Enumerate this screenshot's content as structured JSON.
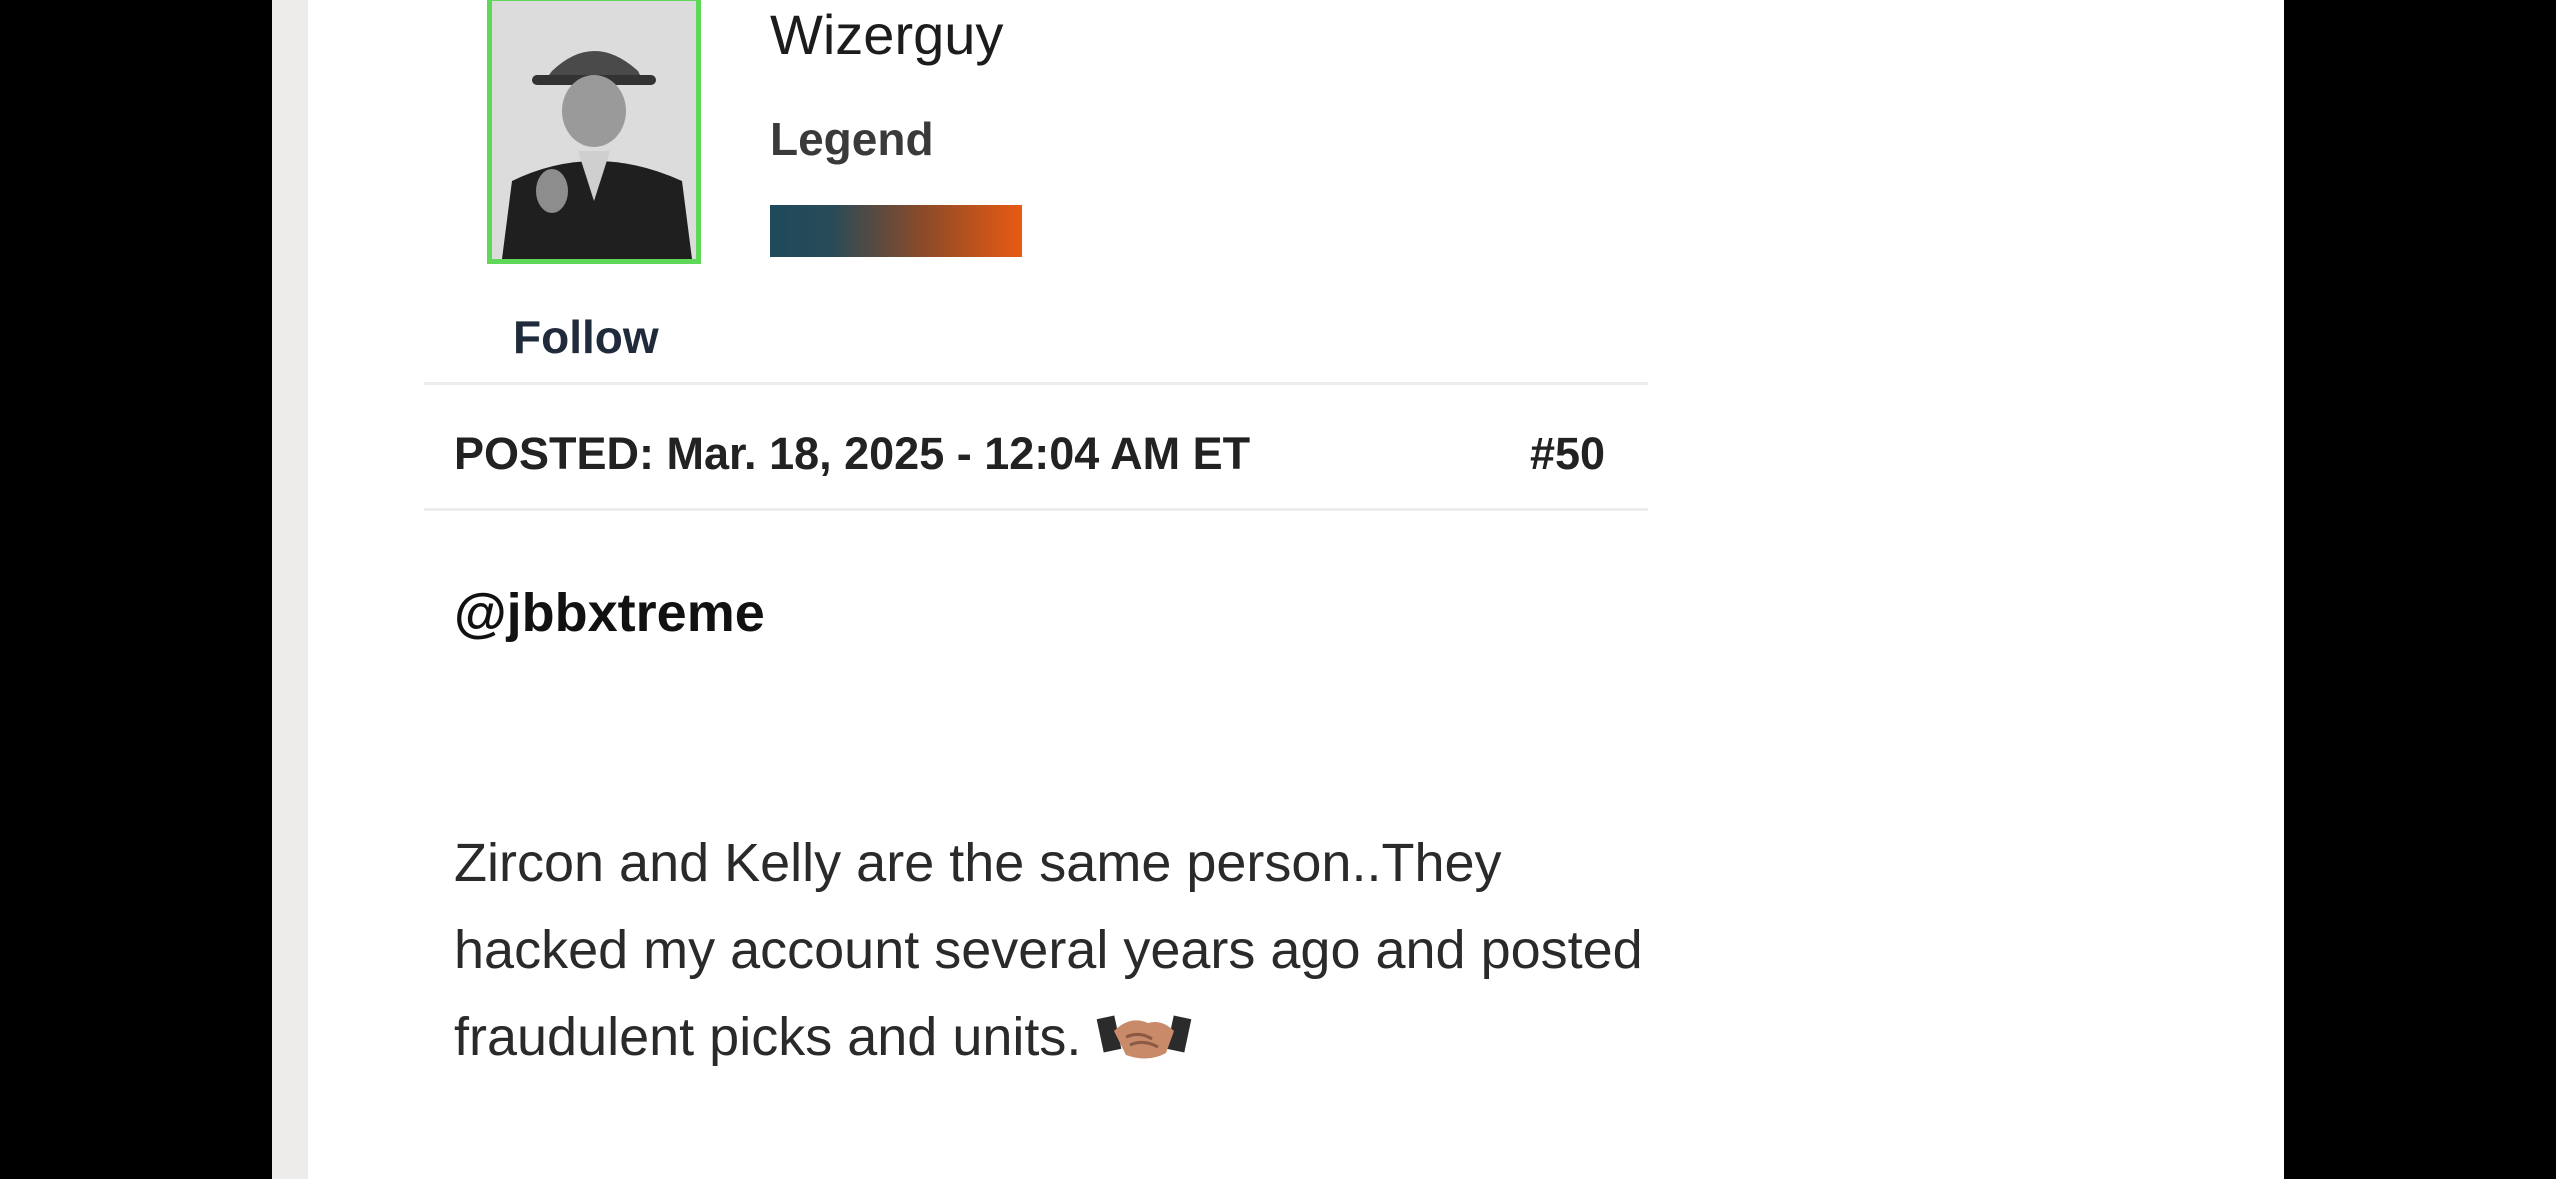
{
  "post": {
    "author": "Wizerguy",
    "rank": "Legend",
    "follow_label": "Follow",
    "posted": "POSTED: Mar. 18, 2025 - 12:04 AM ET",
    "number": "#50",
    "mention": "@jbbxtreme",
    "body_text": " Zircon and Kelly are the same person..They hacked my account several years ago and posted fraudulent picks and units. ",
    "emoji": "handshake-emoji"
  },
  "colors": {
    "avatar_border": "#5fd85a",
    "rank_bar_start": "#1d4a5c",
    "rank_bar_end": "#e85a12"
  }
}
